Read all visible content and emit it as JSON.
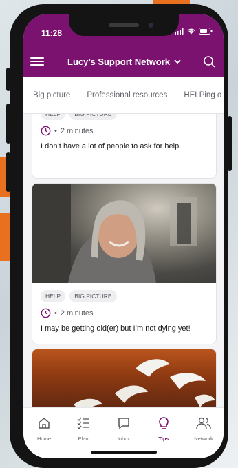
{
  "status_bar": {
    "time": "11:28"
  },
  "header": {
    "title": "Lucy’s Support Network"
  },
  "tabs": [
    {
      "label": "Big picture"
    },
    {
      "label": "Professional resources"
    },
    {
      "label": "HELPing o"
    }
  ],
  "cards": [
    {
      "tags": [
        "HELP",
        "BIG PICTURE"
      ],
      "duration": "2 minutes",
      "title": "I don’t have a lot of people to ask for help"
    },
    {
      "tags": [
        "HELP",
        "BIG PICTURE"
      ],
      "duration": "2 minutes",
      "title": "I may be getting old(er) but I’m not dying yet!"
    }
  ],
  "meta_separator": "•",
  "nav": [
    {
      "label": "Home",
      "icon": "home-icon"
    },
    {
      "label": "Plan",
      "icon": "checklist-icon"
    },
    {
      "label": "Inbox",
      "icon": "chat-icon"
    },
    {
      "label": "Tips",
      "icon": "lightbulb-icon",
      "active": true
    },
    {
      "label": "Network",
      "icon": "people-icon"
    }
  ],
  "colors": {
    "brand": "#7b1270",
    "accent": "#e8701e"
  }
}
